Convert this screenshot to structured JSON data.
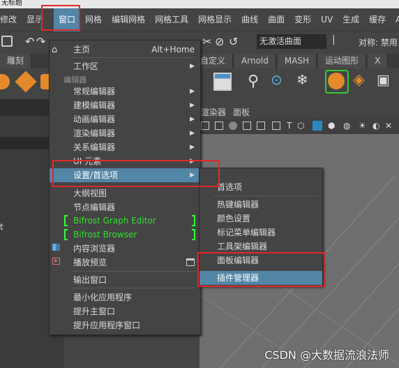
{
  "window": {
    "title": "无标题"
  },
  "menubar": {
    "items": [
      {
        "label": "修改"
      },
      {
        "label": "显示"
      },
      {
        "label": "窗口"
      },
      {
        "label": "网格"
      },
      {
        "label": "编辑网格"
      },
      {
        "label": "网格工具"
      },
      {
        "label": "网格显示"
      },
      {
        "label": "曲线"
      },
      {
        "label": "曲面"
      },
      {
        "label": "变形"
      },
      {
        "label": "UV"
      },
      {
        "label": "生成"
      },
      {
        "label": "缓存"
      },
      {
        "label": "A"
      }
    ]
  },
  "toolbar": {
    "live_surface": "无激活曲面",
    "symmetry": "对称: 禁用"
  },
  "shelf_tabs": [
    "雕刻",
    "自定义",
    "Arnold",
    "MASH",
    "运动图形",
    "X"
  ],
  "panel_menu": [
    "渲染器",
    "面板"
  ],
  "main_menu": {
    "home": {
      "label": "主页",
      "shortcut": "Alt+Home"
    },
    "workspace": "工作区",
    "section_editors": "编辑器",
    "items": [
      {
        "label": "常规编辑器",
        "submenu": true
      },
      {
        "label": "建模编辑器",
        "submenu": true
      },
      {
        "label": "动画编辑器",
        "submenu": true
      },
      {
        "label": "渲染编辑器",
        "submenu": true
      },
      {
        "label": "关系编辑器",
        "submenu": true
      },
      {
        "label": "UI 元素",
        "submenu": true
      },
      {
        "label": "设置/首选项",
        "submenu": true,
        "highlighted": true
      },
      {
        "label": "大纲视图"
      },
      {
        "label": "节点编辑器"
      },
      {
        "label": "Bifrost Graph Editor",
        "green": true
      },
      {
        "label": "Bifrost Browser",
        "green": true
      },
      {
        "label": "内容浏览器"
      },
      {
        "label": "播放预览"
      }
    ],
    "output_window": "输出窗口",
    "bottom_items": [
      "最小化应用程序",
      "提升主窗口",
      "提升应用程序窗口"
    ]
  },
  "sub_menu": {
    "items": [
      {
        "label": "首选项"
      },
      {
        "label": "热键编辑器"
      },
      {
        "label": "颜色设置"
      },
      {
        "label": "标记菜单编辑器"
      },
      {
        "label": "工具架编辑器"
      },
      {
        "label": "面板编辑器"
      },
      {
        "label": "插件管理器",
        "highlighted": true
      }
    ]
  },
  "watermark": "CSDN @大数据流浪法师",
  "left_panel_text": "t",
  "colors": {
    "highlight": "#5285a6",
    "red_annotation": "#e02828",
    "green_text": "#2fe02f"
  }
}
